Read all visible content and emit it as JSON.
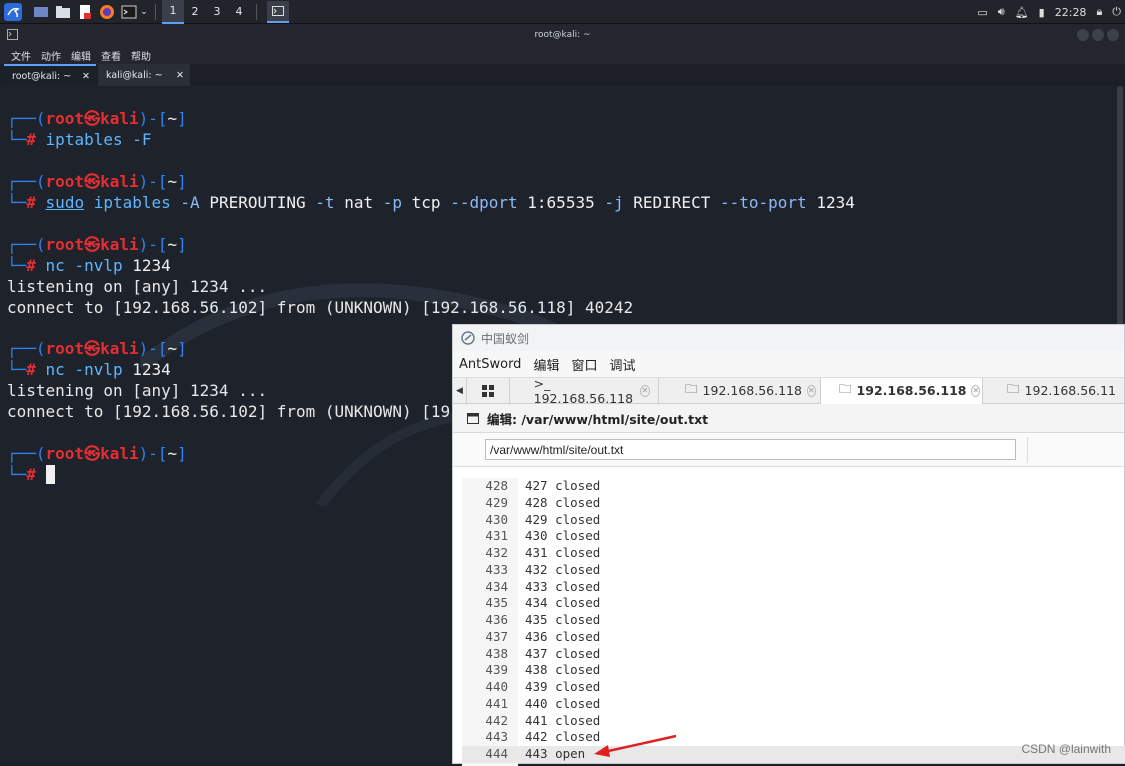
{
  "taskbar": {
    "workspaces": [
      "1",
      "2",
      "3",
      "4"
    ],
    "clock": "22:28"
  },
  "window": {
    "title": "root@kali: ~",
    "menu": [
      "文件",
      "动作",
      "编辑",
      "查看",
      "帮助"
    ],
    "tabs": [
      {
        "label": "root@kali: ~",
        "active": true
      },
      {
        "label": "kali@kali: ~",
        "active": false
      }
    ]
  },
  "terminal": {
    "prompt_user": "root",
    "prompt_host": "kali",
    "prompt_dir": "~",
    "cmd1": "iptables -F",
    "cmd2_sudo": "sudo",
    "cmd2_rest": "iptables",
    "cmd2_a": "-A",
    "cmd2_pre": "PREROUTING",
    "cmd2_t": "-t",
    "cmd2_nat": "nat",
    "cmd2_p": "-p",
    "cmd2_tcp": "tcp",
    "cmd2_dport": "--dport",
    "cmd2_range": "1:65535",
    "cmd2_j": "-j",
    "cmd2_redirect": "REDIRECT",
    "cmd2_toport": "--to-port",
    "cmd2_port": "1234",
    "cmd3": "nc -nvlp",
    "cmd3_port": "1234",
    "listen": "listening on [any] 1234 ...",
    "connect1": "connect to [192.168.56.102] from (UNKNOWN) [192.168.56.118] 40242",
    "connect2": "connect to [192.168.56.102] from (UNKNOWN) [19"
  },
  "antsword": {
    "title": "中国蚁剑",
    "menu": [
      "AntSword",
      "编辑",
      "窗口",
      "调试"
    ],
    "tabs": [
      {
        "label": ">_ 192.168.56.118",
        "icon": "terminal-icon",
        "active": false
      },
      {
        "label": "192.168.56.118",
        "icon": "folder-icon",
        "active": false
      },
      {
        "label": "192.168.56.118",
        "icon": "folder-icon",
        "active": true
      },
      {
        "label": "192.168.56.11",
        "icon": "folder-icon",
        "active": false
      }
    ],
    "editor_label": "编辑: /var/www/html/site/out.txt",
    "path_value": "/var/www/html/site/out.txt",
    "lines": [
      {
        "n": "428",
        "t": "427 closed"
      },
      {
        "n": "429",
        "t": "428 closed"
      },
      {
        "n": "430",
        "t": "429 closed"
      },
      {
        "n": "431",
        "t": "430 closed"
      },
      {
        "n": "432",
        "t": "431 closed"
      },
      {
        "n": "433",
        "t": "432 closed"
      },
      {
        "n": "434",
        "t": "433 closed"
      },
      {
        "n": "435",
        "t": "434 closed"
      },
      {
        "n": "436",
        "t": "435 closed"
      },
      {
        "n": "437",
        "t": "436 closed"
      },
      {
        "n": "438",
        "t": "437 closed"
      },
      {
        "n": "439",
        "t": "438 closed"
      },
      {
        "n": "440",
        "t": "439 closed"
      },
      {
        "n": "441",
        "t": "440 closed"
      },
      {
        "n": "442",
        "t": "441 closed"
      },
      {
        "n": "443",
        "t": "442 closed"
      },
      {
        "n": "444",
        "t": "443 open"
      }
    ]
  },
  "watermark": "CSDN @lainwith",
  "colors": {
    "accent": "#5aa0ff",
    "prompt_red": "#e62e32",
    "prompt_blue": "#2f82f0",
    "arrow": "#e02020"
  }
}
